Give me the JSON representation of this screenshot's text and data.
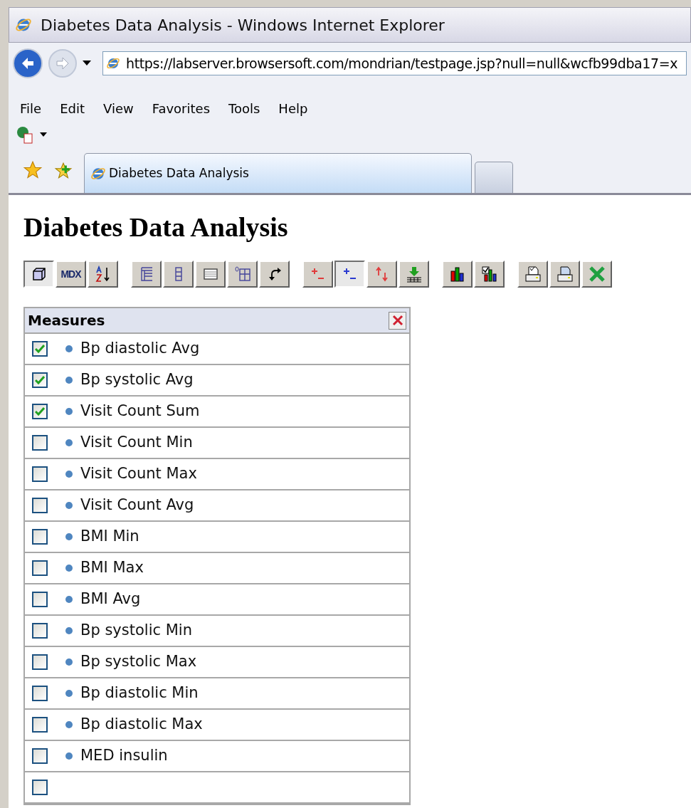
{
  "window": {
    "title": "Diabetes Data Analysis - Windows Internet Explorer"
  },
  "address_bar": {
    "value": "https://labserver.browsersoft.com/mondrian/testpage.jsp?null=null&wcfb99dba17=x"
  },
  "menu": [
    "File",
    "Edit",
    "View",
    "Favorites",
    "Tools",
    "Help"
  ],
  "tabs": [
    {
      "label": "Diabetes Data Analysis",
      "selected": true
    }
  ],
  "page": {
    "heading": "Diabetes Data Analysis"
  },
  "toolbar": [
    [
      {
        "kind": "cube",
        "selected": true
      },
      {
        "kind": "mdx",
        "label": "MDX",
        "selected": false
      },
      {
        "kind": "sort",
        "selected": false
      }
    ],
    [
      {
        "kind": "tree",
        "selected": false
      },
      {
        "kind": "columns",
        "selected": false
      },
      {
        "kind": "table",
        "selected": false
      },
      {
        "kind": "zerogrid",
        "selected": false
      },
      {
        "kind": "swap",
        "selected": false
      }
    ],
    [
      {
        "kind": "plusminus-red",
        "selected": false
      },
      {
        "kind": "plusminus-blue",
        "selected": true
      },
      {
        "kind": "updown",
        "selected": false
      },
      {
        "kind": "drill",
        "selected": false
      }
    ],
    [
      {
        "kind": "chart",
        "selected": false
      },
      {
        "kind": "chartcheck",
        "selected": false
      }
    ],
    [
      {
        "kind": "printsetup",
        "selected": false
      },
      {
        "kind": "print",
        "selected": false
      },
      {
        "kind": "excel",
        "selected": false
      }
    ]
  ],
  "measures": {
    "title": "Measures",
    "items": [
      {
        "label": "Bp diastolic Avg",
        "checked": true
      },
      {
        "label": "Bp systolic Avg",
        "checked": true
      },
      {
        "label": "Visit Count Sum",
        "checked": true
      },
      {
        "label": "Visit Count Min",
        "checked": false
      },
      {
        "label": "Visit Count Max",
        "checked": false
      },
      {
        "label": "Visit Count Avg",
        "checked": false
      },
      {
        "label": "BMI Min",
        "checked": false
      },
      {
        "label": "BMI Max",
        "checked": false
      },
      {
        "label": "BMI Avg",
        "checked": false
      },
      {
        "label": "Bp systolic Min",
        "checked": false
      },
      {
        "label": "Bp systolic Max",
        "checked": false
      },
      {
        "label": "Bp diastolic Min",
        "checked": false
      },
      {
        "label": "Bp diastolic Max",
        "checked": false
      },
      {
        "label": "MED insulin",
        "checked": false
      },
      {
        "checked": false
      }
    ]
  }
}
